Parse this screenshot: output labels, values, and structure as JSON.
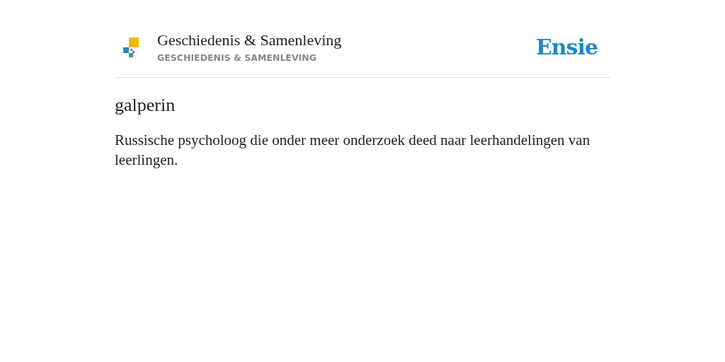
{
  "header": {
    "title": "Geschiedenis & Samenleving",
    "subtitle": "GESCHIEDENIS & SAMENLEVING",
    "brand": "Ensie"
  },
  "entry": {
    "term": "galperin",
    "definition": "Russische psycholoog die onder meer onderzoek deed naar leerhandelingen van leerlingen."
  }
}
